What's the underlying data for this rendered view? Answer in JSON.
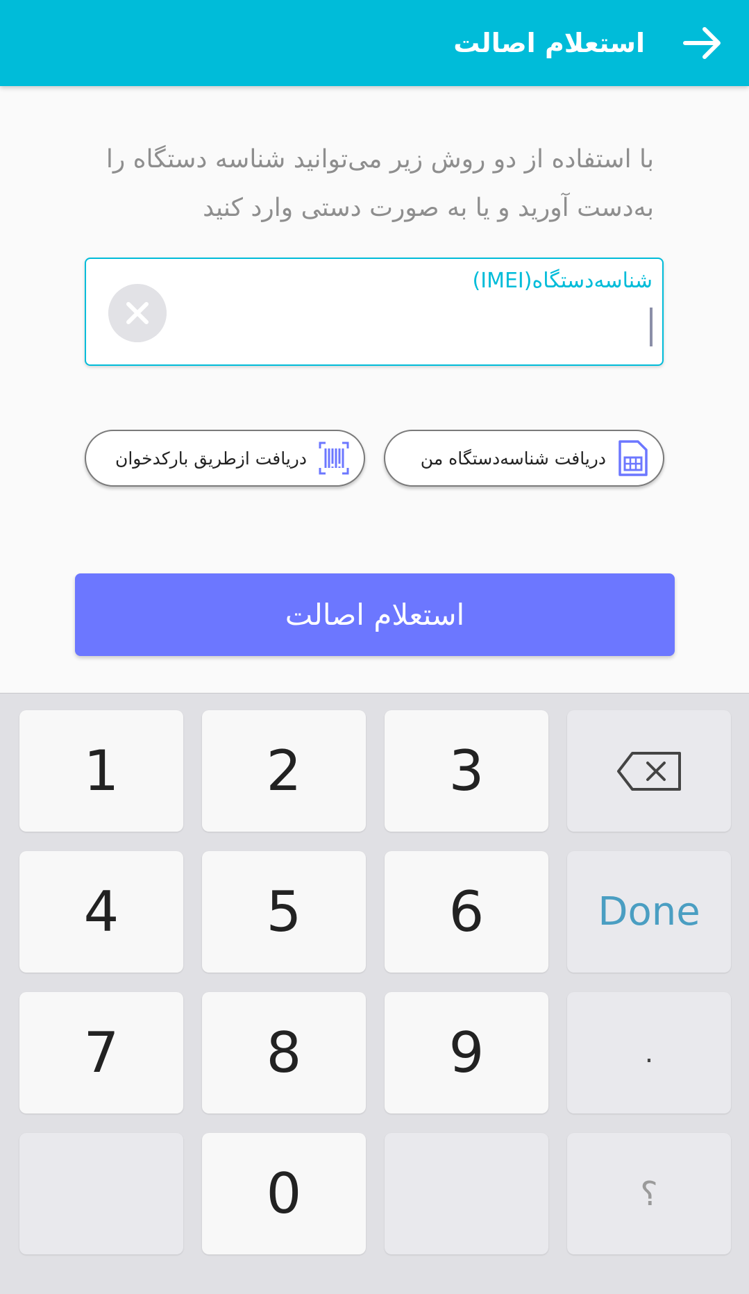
{
  "header": {
    "title": "استعلام اصالت",
    "back_icon": "arrow-right-icon"
  },
  "intro_text": "با استفاده از دو روش زیر می‌توانید شناسه دستگاه را به‌دست آورید و یا به صورت دستی وارد کنید",
  "imei_field": {
    "label": "شناسه‌دستگاه(IMEI)",
    "value": ""
  },
  "buttons": {
    "get_my_device_id": "دریافت شناسه‌دستگاه من",
    "get_via_barcode": "دریافت ازطریق بارکدخوان",
    "inquire": "استعلام اصالت"
  },
  "keyboard": {
    "keys": [
      "1",
      "2",
      "3",
      "4",
      "5",
      "6",
      "7",
      "8",
      "9",
      "0"
    ],
    "done": "Done",
    "dot": ".",
    "question": "؟"
  },
  "colors": {
    "header": "#00bcd9",
    "primary_button": "#6c77ff",
    "accent": "#00bcd9"
  }
}
